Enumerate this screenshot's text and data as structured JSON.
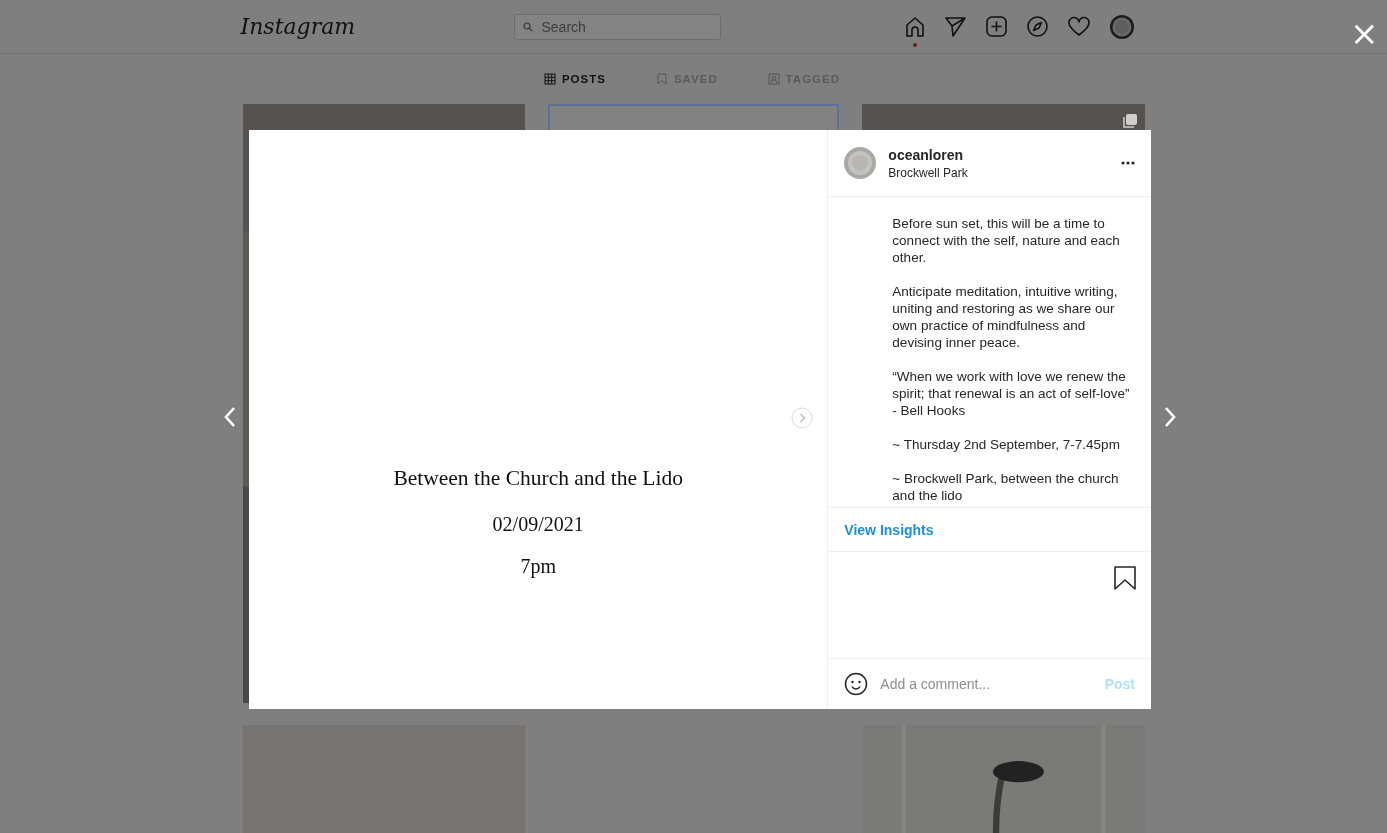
{
  "header": {
    "logo": "Instagram",
    "search": {
      "placeholder": "Search"
    }
  },
  "close": "×",
  "profile_tabs": [
    {
      "label": "POSTS",
      "selected": true
    },
    {
      "label": "SAVED",
      "selected": false
    },
    {
      "label": "TAGGED",
      "selected": false
    }
  ],
  "grid": [
    {
      "kind": "picture"
    },
    {
      "kind": "outlined"
    },
    {
      "kind": "picture"
    },
    {
      "kind": "picture"
    },
    {
      "kind": "empty"
    },
    {
      "kind": "picture"
    }
  ],
  "post": {
    "image_text": [
      "Between the Church and the Lido",
      "02/09/2021",
      "7pm"
    ],
    "username": "oceanloren",
    "location": "Brockwell Park",
    "caption": [
      "Before sun set, this will be a time to connect with the self, nature and each other.",
      "Anticipate meditation, intuitive writing, uniting and restoring as we share our own practice of mindfulness and devising inner peace.",
      "“When we work with love we renew the spirit; that renewal is an act of self-love” - Bell Hooks",
      "~ Thursday 2nd September, 7-7.45pm",
      "~ Brockwell Park, between the church and the lido"
    ],
    "insights_link": "View Insights",
    "comment": {
      "placeholder": "Add a comment...",
      "post_button": "Post",
      "post_disabled": true
    }
  }
}
